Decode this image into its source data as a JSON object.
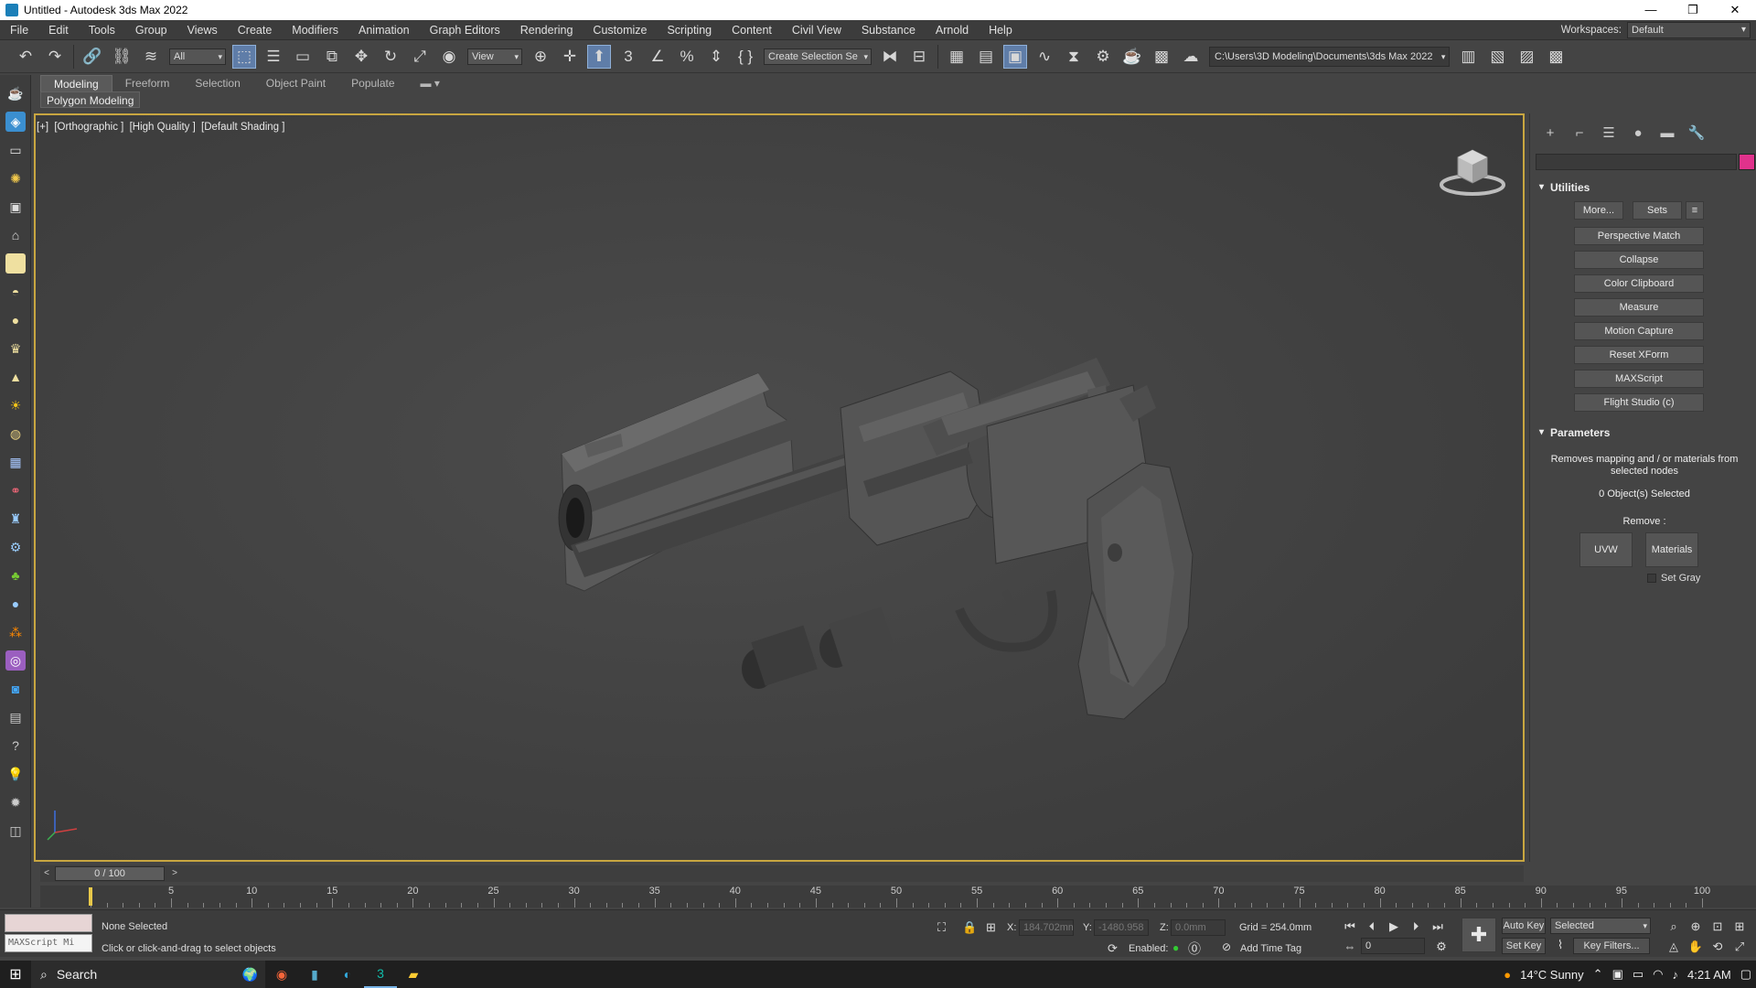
{
  "window": {
    "title": "Untitled - Autodesk 3ds Max 2022",
    "controls": [
      "—",
      "❐",
      "✕"
    ]
  },
  "menu": [
    "File",
    "Edit",
    "Tools",
    "Group",
    "Views",
    "Create",
    "Modifiers",
    "Animation",
    "Graph Editors",
    "Rendering",
    "Customize",
    "Scripting",
    "Content",
    "Civil View",
    "Substance",
    "Arnold",
    "Help"
  ],
  "workspace": {
    "label": "Workspaces:",
    "value": "Default"
  },
  "toolbar": {
    "filter": "All",
    "ref_coord": "View",
    "selection_set": "Create Selection Se",
    "project_path": "C:\\Users\\3D Modeling\\Documents\\3ds Max 2022"
  },
  "ribbon": {
    "tabs": [
      "Modeling",
      "Freeform",
      "Selection",
      "Object Paint",
      "Populate"
    ],
    "active_tab": "Modeling",
    "sub_label": "Polygon Modeling"
  },
  "viewport": {
    "label_parts": [
      "[+]",
      "[Orthographic ]",
      "[High Quality ]",
      "[Default Shading ]"
    ]
  },
  "command_panel": {
    "utilities": {
      "title": "Utilities",
      "more": "More...",
      "sets": "Sets",
      "buttons": [
        "Perspective Match",
        "Collapse",
        "Color Clipboard",
        "Measure",
        "Motion Capture",
        "Reset XForm",
        "MAXScript",
        "Flight Studio (c)"
      ]
    },
    "parameters": {
      "title": "Parameters",
      "description": "Removes mapping and / or materials from selected nodes",
      "selected": "0 Object(s) Selected",
      "remove_label": "Remove :",
      "uvw": "UVW",
      "materials": "Materials",
      "set_gray": "Set Gray"
    }
  },
  "timeline": {
    "frame": "0 / 100",
    "ticks": [
      "5",
      "10",
      "15",
      "20",
      "25",
      "30",
      "35",
      "40",
      "45",
      "50",
      "55",
      "60",
      "65",
      "70",
      "75",
      "80",
      "85",
      "90",
      "95",
      "100"
    ]
  },
  "status": {
    "maxscript_placeholder": "MAXScript Mi",
    "selection": "None Selected",
    "prompt": "Click or click-and-drag to select objects",
    "x_label": "X:",
    "x_value": "184.702mm",
    "y_label": "Y:",
    "y_value": "-1480.958",
    "z_label": "Z:",
    "z_value": "0.0mm",
    "grid": "Grid = 254.0mm",
    "enabled_label": "Enabled:",
    "time_tag": "Add Time Tag",
    "auto_key": "Auto Key",
    "set_key": "Set Key",
    "key_mode": "Selected",
    "key_filters": "Key Filters...",
    "current_frame": "0"
  },
  "taskbar": {
    "search": "Search",
    "weather": "14°C  Sunny",
    "time": "4:21 AM"
  }
}
